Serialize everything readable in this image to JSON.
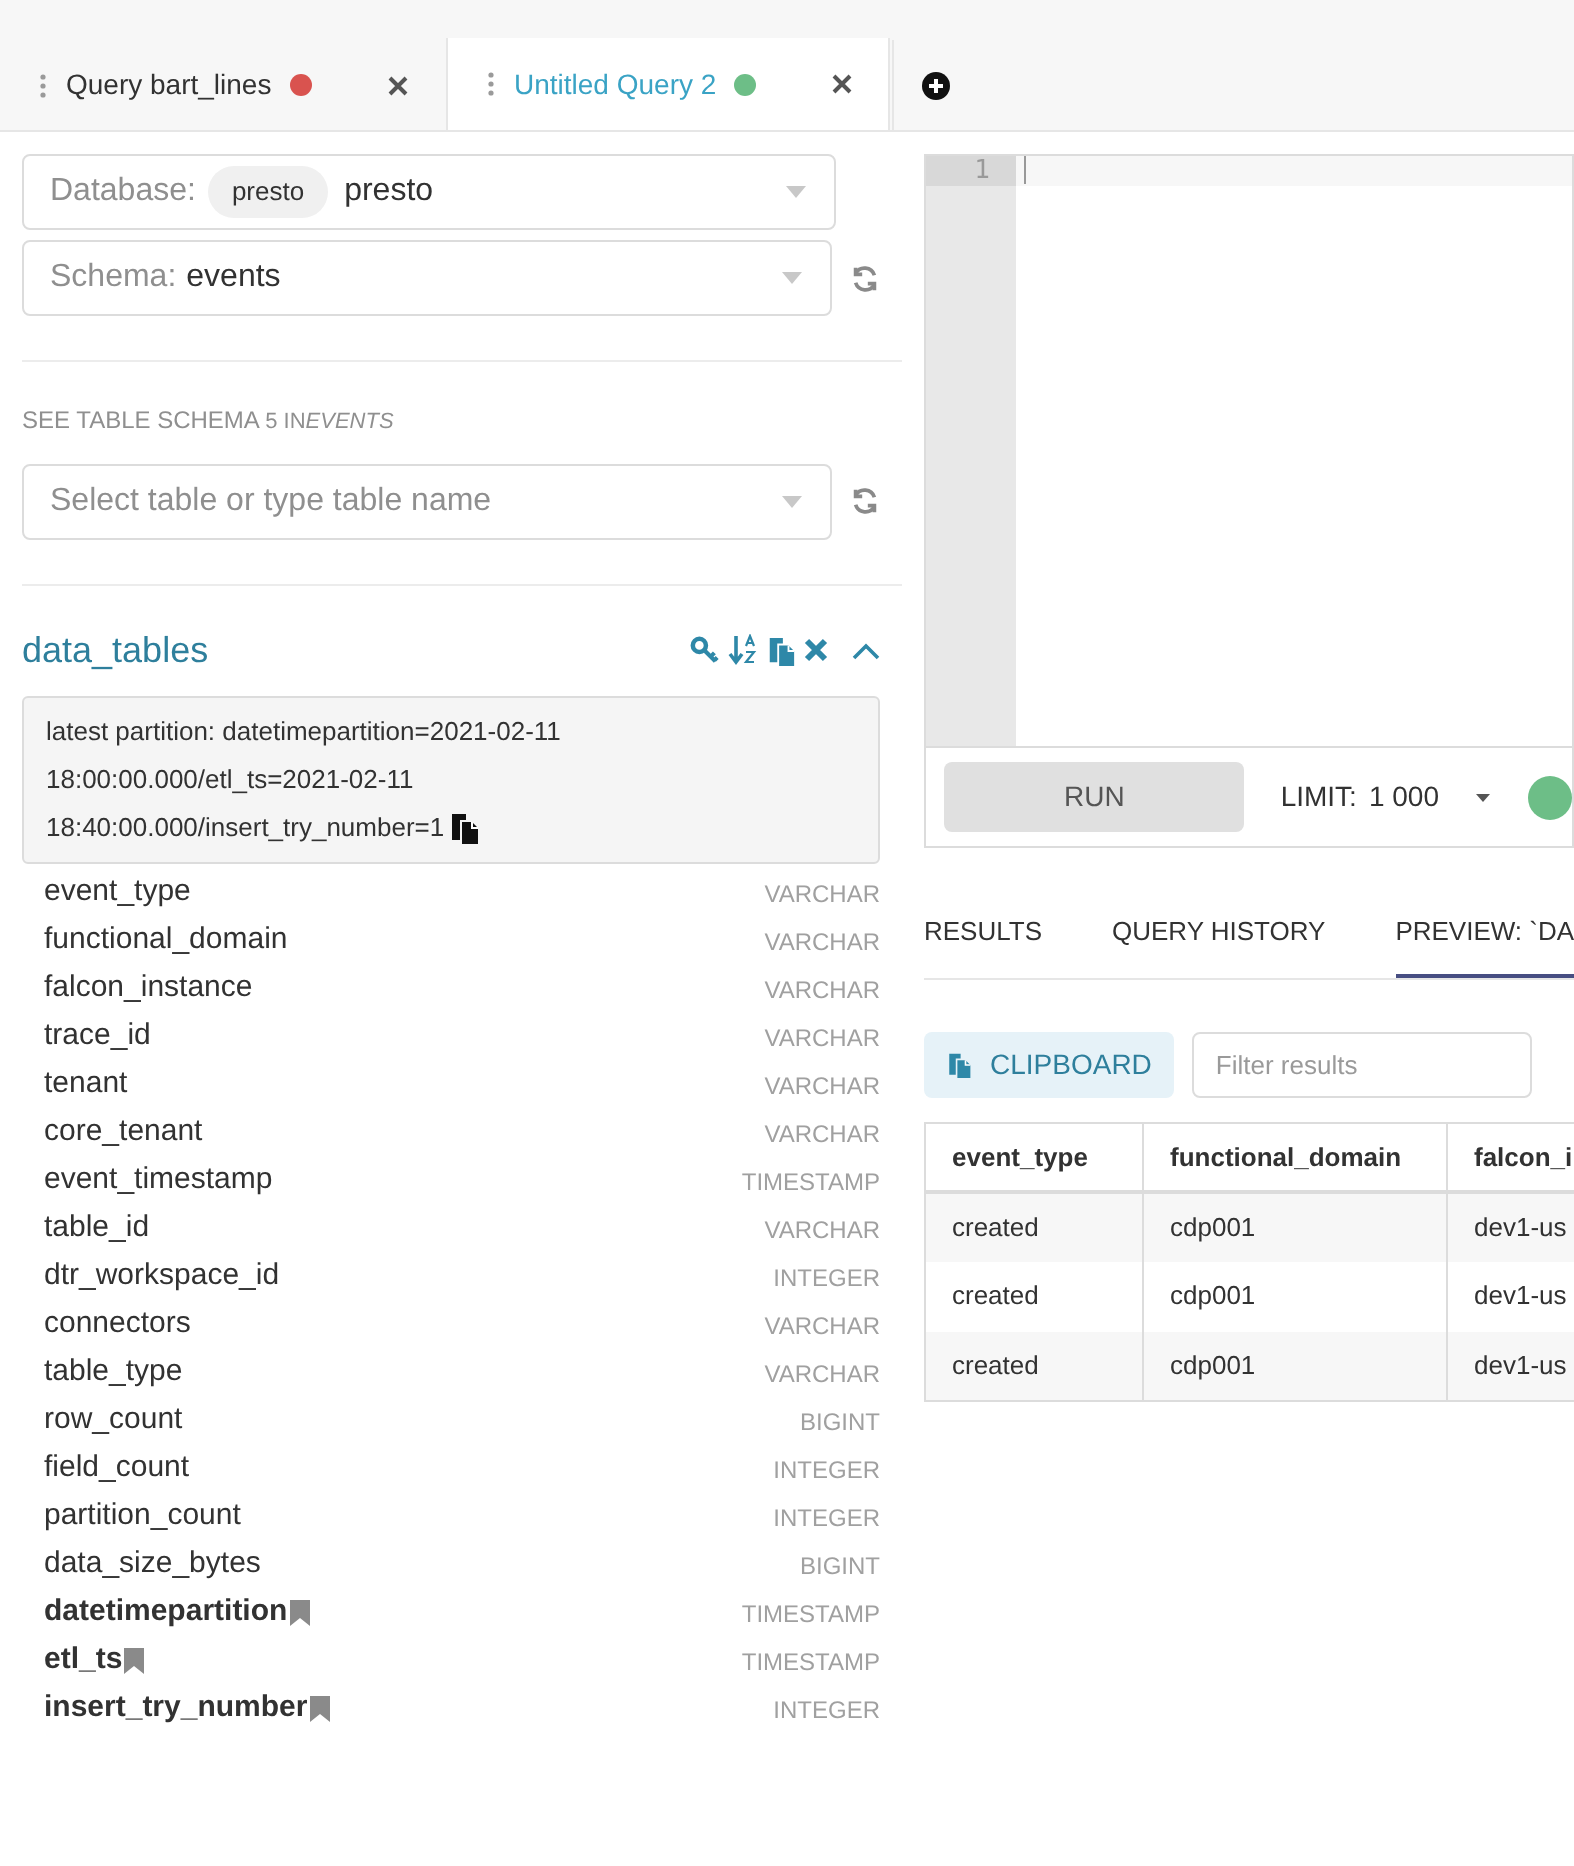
{
  "query_tabs": [
    {
      "label": "Query bart_lines",
      "selected": false,
      "color": "#d9534f"
    },
    {
      "label": "Untitled Query 2",
      "selected": true,
      "color": "#6dbe87"
    }
  ],
  "database": {
    "label": "Database:",
    "chip": "presto",
    "value": "presto"
  },
  "schema": {
    "label": "Schema:",
    "value": "events"
  },
  "table_schema_heading": {
    "title": "SEE TABLE SCHEMA",
    "count": "5 IN",
    "schema": "EVENTS"
  },
  "table_select": {
    "placeholder": "Select table or type table name"
  },
  "table": {
    "name": "data_tables",
    "partition_info": [
      "latest partition: datetimepartition=2021-02-11",
      "18:00:00.000/etl_ts=2021-02-11",
      "18:40:00.000/insert_try_number=1"
    ],
    "columns": [
      {
        "name": "event_type",
        "type": "VARCHAR",
        "partition": false
      },
      {
        "name": "functional_domain",
        "type": "VARCHAR",
        "partition": false
      },
      {
        "name": "falcon_instance",
        "type": "VARCHAR",
        "partition": false
      },
      {
        "name": "trace_id",
        "type": "VARCHAR",
        "partition": false
      },
      {
        "name": "tenant",
        "type": "VARCHAR",
        "partition": false
      },
      {
        "name": "core_tenant",
        "type": "VARCHAR",
        "partition": false
      },
      {
        "name": "event_timestamp",
        "type": "TIMESTAMP",
        "partition": false
      },
      {
        "name": "table_id",
        "type": "VARCHAR",
        "partition": false
      },
      {
        "name": "dtr_workspace_id",
        "type": "INTEGER",
        "partition": false
      },
      {
        "name": "connectors",
        "type": "VARCHAR",
        "partition": false
      },
      {
        "name": "table_type",
        "type": "VARCHAR",
        "partition": false
      },
      {
        "name": "row_count",
        "type": "BIGINT",
        "partition": false
      },
      {
        "name": "field_count",
        "type": "INTEGER",
        "partition": false
      },
      {
        "name": "partition_count",
        "type": "INTEGER",
        "partition": false
      },
      {
        "name": "data_size_bytes",
        "type": "BIGINT",
        "partition": false
      },
      {
        "name": "datetimepartition",
        "type": "TIMESTAMP",
        "partition": true
      },
      {
        "name": "etl_ts",
        "type": "TIMESTAMP",
        "partition": true
      },
      {
        "name": "insert_try_number",
        "type": "INTEGER",
        "partition": true
      }
    ]
  },
  "editor": {
    "line_numbers": [
      "1"
    ]
  },
  "run_button": "RUN",
  "limit": {
    "label": "LIMIT:",
    "value": "1 000"
  },
  "result_tabs": [
    {
      "label": "RESULTS",
      "selected": false
    },
    {
      "label": "QUERY HISTORY",
      "selected": false
    },
    {
      "label": "PREVIEW: `DA",
      "selected": true
    }
  ],
  "clipboard_button": "CLIPBOARD",
  "filter": {
    "placeholder": "Filter results"
  },
  "preview": {
    "columns": [
      "event_type",
      "functional_domain",
      "falcon_i"
    ],
    "rows": [
      [
        "created",
        "cdp001",
        "dev1-us"
      ],
      [
        "created",
        "cdp001",
        "dev1-us"
      ],
      [
        "created",
        "cdp001",
        "dev1-us"
      ]
    ]
  }
}
